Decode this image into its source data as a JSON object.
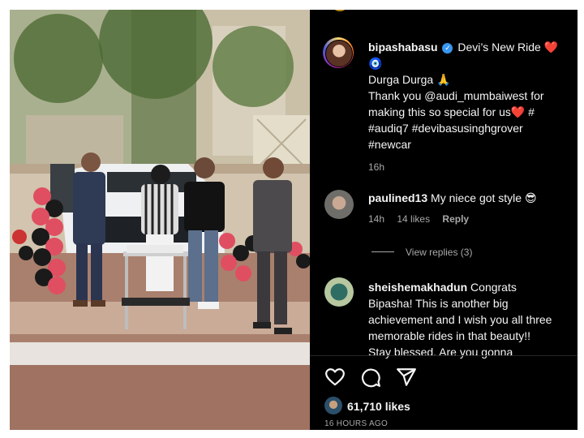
{
  "post": {
    "username": "bipashabasu",
    "caption_title": "Devi’s New Ride",
    "caption_title_emoji": "❤️ 🧿",
    "caption_lines": [
      "Durga Durga 🙏",
      "Thank you @audi_mumbaiwest for",
      "making this so special for us❤️ #",
      "#audiq7 #devibasusinghgrover",
      "#newcar"
    ],
    "age": "16h"
  },
  "comments": [
    {
      "username": "paulined13",
      "text": "My niece got style 😎",
      "age": "14h",
      "likes": "14 likes",
      "reply_label": "Reply"
    },
    {
      "username": "sheishemakhadun",
      "text_lines": [
        "Congrats",
        "Bipasha! This is another big",
        "achievement and I wish you all three",
        "memorable rides in that beauty!!",
        "Stay blessed. Are you gonna"
      ]
    }
  ],
  "view_replies": "View replies (3)",
  "footer": {
    "likes": "61,710 likes",
    "timestamp": "16 HOURS AGO"
  },
  "icons": {
    "like": "heart-icon",
    "comment": "comment-bubble-icon",
    "share": "share-arrow-icon",
    "verified": "verified-badge-icon"
  },
  "colors": {
    "panel_bg": "#000000",
    "text": "#f5f5f5",
    "muted": "#a8a8a8",
    "verified": "#3897f0"
  }
}
